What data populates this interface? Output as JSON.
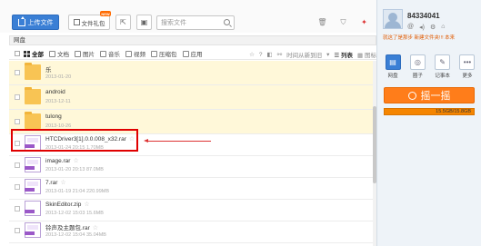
{
  "toolbar": {
    "upload_label": "上传文件",
    "gift_label": "文件礼包",
    "new_badge": "NEW",
    "search_placeholder": "搜索文件"
  },
  "breadcrumb": "网盘",
  "categories": [
    {
      "label": "全部",
      "active": true
    },
    {
      "label": "文档"
    },
    {
      "label": "图片"
    },
    {
      "label": "音乐"
    },
    {
      "label": "视频"
    },
    {
      "label": "压缩包"
    },
    {
      "label": "应用"
    }
  ],
  "category_right": {
    "sort_label": "时间从新到旧",
    "list_view": "列表",
    "icon_view": "图标"
  },
  "files": [
    {
      "name": "乐",
      "meta": "2013-01-20",
      "type": "folder"
    },
    {
      "name": "android",
      "meta": "2013-12-11",
      "type": "folder"
    },
    {
      "name": "tulong",
      "meta": "2013-10-26",
      "type": "folder"
    },
    {
      "name": "HTCDriver3[1].0.0.008_x32.rar",
      "meta": "2013-01-24 20:15   1.70MB",
      "type": "rar"
    },
    {
      "name": "image.rar",
      "meta": "2013-01-20 20:13   87.0MB",
      "type": "rar"
    },
    {
      "name": "7.rar",
      "meta": "2013-01-19 21:04   220.99MB",
      "type": "rar"
    },
    {
      "name": "SkinEditor.zip",
      "meta": "2013-12-02 15:03   15.6MB",
      "type": "zip"
    },
    {
      "name": "铃声及主题包.rar",
      "meta": "2013-12-02 15:04   35.04MB",
      "type": "rar"
    }
  ],
  "user": {
    "id": "84334041",
    "promo": "就这了是那步 新建文件夹!!! 本来"
  },
  "side_tabs": [
    {
      "label": "网盘",
      "icon": "disk-icon",
      "active": true
    },
    {
      "label": "圈子",
      "icon": "circle-icon"
    },
    {
      "label": "记事本",
      "icon": "notepad-icon"
    },
    {
      "label": "更多",
      "icon": "more-icon"
    }
  ],
  "shake_label": "摇一摇",
  "quota": "15.5GB/15.8GB",
  "colors": {
    "accent": "#3a7fd5",
    "orange": "#ff7d1a",
    "highlight_box": "#e00000"
  }
}
